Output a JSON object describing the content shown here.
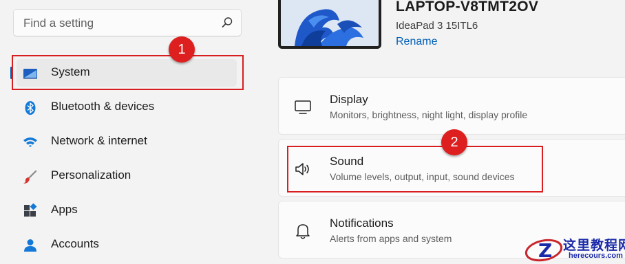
{
  "search": {
    "placeholder": "Find a setting",
    "icon": "search-icon"
  },
  "nav": {
    "items": [
      {
        "label": "System",
        "icon": "system-display-icon",
        "selected": true
      },
      {
        "label": "Bluetooth & devices",
        "icon": "bluetooth-icon"
      },
      {
        "label": "Network & internet",
        "icon": "wifi-icon"
      },
      {
        "label": "Personalization",
        "icon": "paint-brush-icon"
      },
      {
        "label": "Apps",
        "icon": "apps-icon"
      },
      {
        "label": "Accounts",
        "icon": "account-icon"
      }
    ]
  },
  "device": {
    "name": "LAPTOP-V8TMT2OV",
    "model": "IdeaPad 3 15ITL6",
    "rename_label": "Rename"
  },
  "cards": [
    {
      "title": "Display",
      "subtitle": "Monitors, brightness, night light, display profile",
      "icon": "monitor-icon"
    },
    {
      "title": "Sound",
      "subtitle": "Volume levels, output, input, sound devices",
      "icon": "speaker-icon"
    },
    {
      "title": "Notifications",
      "subtitle": "Alerts from apps and system",
      "icon": "bell-icon"
    }
  ],
  "annotations": {
    "badge1": "1",
    "badge2": "2",
    "color": "#d81e1e"
  },
  "watermark": {
    "cn": "这里教程网",
    "url": "herecours.com"
  },
  "colors": {
    "accent": "#005fb8",
    "background": "#f3f3f3",
    "card": "#fbfbfb"
  }
}
